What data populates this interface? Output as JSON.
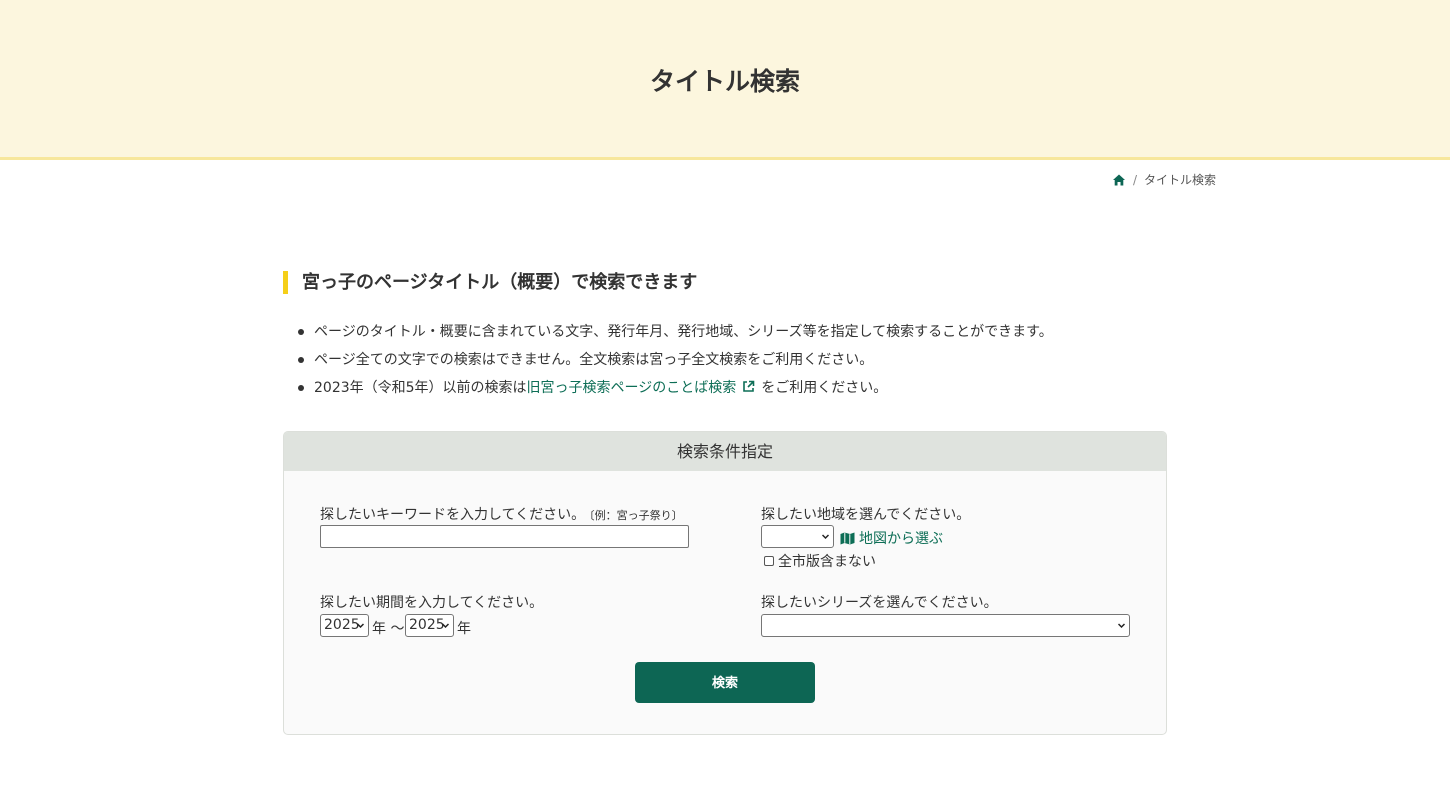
{
  "hero": {
    "title": "タイトル検索"
  },
  "breadcrumb": {
    "home_icon": "home-icon",
    "current": "タイトル検索"
  },
  "section": {
    "heading": "宮っ子のページタイトル（概要）で検索できます"
  },
  "notes": {
    "item1": "ページのタイトル・概要に含まれている文字、発行年月、発行地域、シリーズ等を指定して検索することができます。",
    "item2": "ページ全ての文字での検索はできません。全文検索は宮っ子全文検索をご利用ください。",
    "item3_prefix": "2023年（令和5年）以前の検索は",
    "item3_link": "旧宮っ子検索ページのことば検索",
    "item3_suffix": "をご利用ください。"
  },
  "panel": {
    "title": "検索条件指定",
    "keyword_label": "探したいキーワードを入力してください。",
    "keyword_example": "〔例：宮っ子祭り〕",
    "keyword_value": "",
    "region_label": "探したい地域を選んでください。",
    "region_selected": "",
    "map_link": "地図から選ぶ",
    "exclude_all_city": "全市版含まない",
    "exclude_all_city_checked": false,
    "period_label": "探したい期間を入力してください。",
    "year_from": "2025",
    "year_unit1": "年 〜",
    "year_to": "2025",
    "year_unit2": "年",
    "series_label": "探したいシリーズを選んでください。",
    "series_selected": "",
    "search_button": "検索"
  },
  "colors": {
    "accent": "#0d6654",
    "link": "#0d6e56",
    "hero_bg": "#fcf6de",
    "heading_bar": "#f5cf19"
  }
}
